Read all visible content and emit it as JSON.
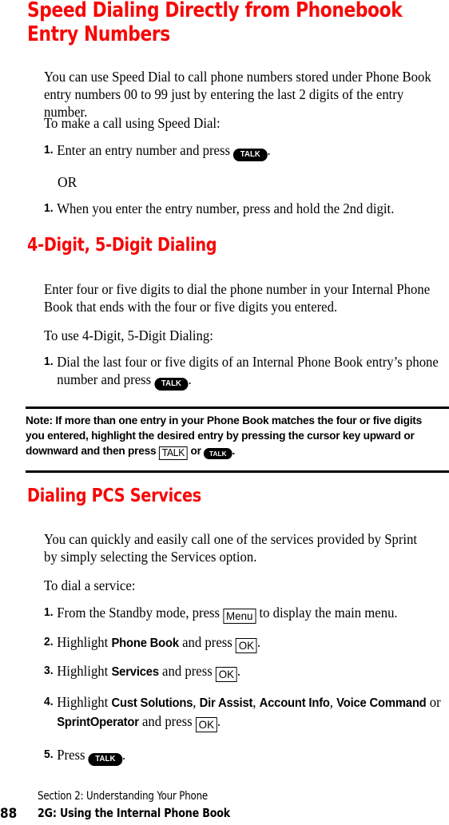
{
  "page": {
    "number": "88",
    "footer": {
      "section": "Section 2: Understanding Your Phone",
      "subsection": "2G: Using the Internal Phone Book"
    },
    "accent_color": "#F60808"
  },
  "sections": [
    {
      "id": "speed-dialing",
      "heading_line1": "Speed Dialing Directly from Phonebook",
      "heading_line2": "Entry Numbers",
      "intro": "You can use Speed Dial to call phone numbers stored under Phone Book entry numbers 00 to 99 just by entering the last 2 digits of the entry number.",
      "lead_in": "To make a call using Speed Dial:",
      "steps": [
        {
          "num": "1.",
          "text_before": "Enter an entry number and press ",
          "key": "TALK",
          "key_style": "pill",
          "text_after": "."
        },
        {
          "num": "1.",
          "text_before": "When you enter the entry number, press and hold the 2nd digit.",
          "key": "",
          "key_style": "none",
          "text_after": ""
        }
      ],
      "or_label": "OR"
    },
    {
      "id": "four-five-digit-dialing",
      "heading": "4-Digit, 5-Digit Dialing",
      "intro": "Enter four or five digits to dial the phone number in your Internal Phone Book that ends with the four or five digits you entered.",
      "lead_in": "To use 4-Digit, 5-Digit Dialing:",
      "step_num": "1.",
      "step_text_before": "Dial the last four or five digits of an Internal Phone Book entry’s phone number and press ",
      "step_key": "TALK",
      "step_text_after": "."
    },
    {
      "id": "dialing-pcs-services",
      "heading": "Dialing PCS Services",
      "intro": "You can quickly and easily call one of the services provided by Sprint by simply selecting the Services option.",
      "lead_in": "To dial a service:"
    }
  ],
  "note": {
    "label": "Note:",
    "text_part1": " If more than one entry in your Phone Book matches the four or five digits you entered, highlight the desired entry by pressing the cursor key upward or downward and then press ",
    "key_boxed": "TALK",
    "text_part2": " or ",
    "key_pill": "TALK",
    "text_part3": "."
  },
  "service_steps": [
    {
      "num": "1.",
      "parts": [
        {
          "type": "text",
          "value": "From the Standby mode, press "
        },
        {
          "type": "key-box",
          "value": "Menu"
        },
        {
          "type": "text",
          "value": " to display the main menu."
        }
      ]
    },
    {
      "num": "2.",
      "parts": [
        {
          "type": "text",
          "value": "Highlight "
        },
        {
          "type": "bold",
          "value": "Phone Book"
        },
        {
          "type": "text",
          "value": " and press "
        },
        {
          "type": "key-box",
          "value": "OK"
        },
        {
          "type": "text",
          "value": "."
        }
      ]
    },
    {
      "num": "3.",
      "parts": [
        {
          "type": "text",
          "value": "Highlight "
        },
        {
          "type": "bold",
          "value": "Services"
        },
        {
          "type": "text",
          "value": " and press "
        },
        {
          "type": "key-box",
          "value": "OK"
        },
        {
          "type": "text",
          "value": "."
        }
      ]
    },
    {
      "num": "4.",
      "parts": [
        {
          "type": "text",
          "value": "Highlight "
        },
        {
          "type": "bold",
          "value": "Cust Solutions"
        },
        {
          "type": "text",
          "value": ", "
        },
        {
          "type": "bold",
          "value": "Dir Assist"
        },
        {
          "type": "text",
          "value": ", "
        },
        {
          "type": "bold",
          "value": "Account Info"
        },
        {
          "type": "text",
          "value": ", "
        },
        {
          "type": "bold",
          "value": "Voice Command"
        },
        {
          "type": "text",
          "value": " or "
        },
        {
          "type": "bold",
          "value": "SprintOperator"
        },
        {
          "type": "text",
          "value": " and press "
        },
        {
          "type": "key-box",
          "value": "OK"
        },
        {
          "type": "text",
          "value": "."
        }
      ]
    },
    {
      "num": "5.",
      "parts": [
        {
          "type": "text",
          "value": "Press "
        },
        {
          "type": "key-pill",
          "value": "TALK"
        },
        {
          "type": "text",
          "value": "."
        }
      ]
    }
  ]
}
